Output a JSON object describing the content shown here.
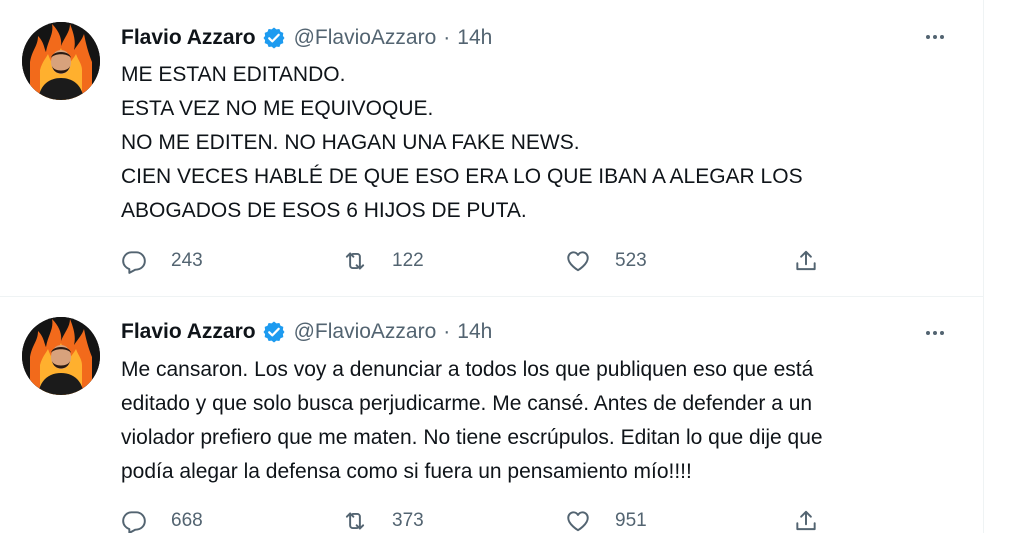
{
  "tweets": [
    {
      "author_name": "Flavio Azzaro",
      "handle": "@FlavioAzzaro",
      "separator": "·",
      "time": "14h",
      "more_icon": "more-horizontal-icon",
      "lines": [
        "ME ESTAN EDITANDO.",
        "ESTA VEZ NO ME EQUIVOQUE.",
        "NO ME EDITEN. NO HAGAN UNA FAKE NEWS.",
        "CIEN VECES HABLÉ DE QUE ESO ERA LO QUE IBAN A ALEGAR LOS",
        "ABOGADOS DE ESOS 6 HIJOS DE PUTA."
      ],
      "replies": "243",
      "retweets": "122",
      "likes": "523"
    },
    {
      "author_name": "Flavio Azzaro",
      "handle": "@FlavioAzzaro",
      "separator": "·",
      "time": "14h",
      "more_icon": "more-horizontal-icon",
      "lines": [
        "Me cansaron. Los voy a denunciar a todos los que publiquen eso que está",
        "editado y que solo busca perjudicarme. Me cansé. Antes de defender a un",
        "violador prefiero que me maten. No tiene escrúpulos. Editan lo que dije que",
        "podía alegar la defensa como si fuera un pensamiento mío!!!!"
      ],
      "replies": "668",
      "retweets": "373",
      "likes": "951"
    }
  ],
  "colors": {
    "text": "#0f1419",
    "secondary": "#536471",
    "verified": "#1d9bf0",
    "divider": "#eff3f4",
    "avatar_fire": "#f26a1b"
  }
}
